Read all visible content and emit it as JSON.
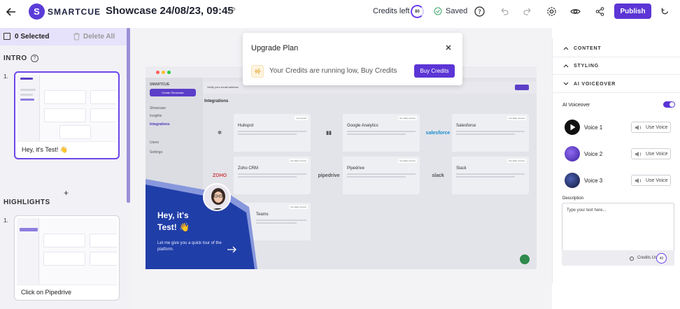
{
  "header": {
    "logo_text": "SMARTCUE",
    "logo_letter": "S",
    "doc_title": "Showcase 24/08/23, 09:45",
    "credits_left_label": "Credits left",
    "credits_left_value": "80",
    "saved_label": "Saved",
    "publish_label": "Publish"
  },
  "left_panel": {
    "selected_label": "0 Selected",
    "delete_all_label": "Delete All",
    "sections": [
      {
        "title": "INTRO",
        "steps": [
          {
            "number": "1.",
            "caption": "Hey, it's Test! 👋"
          }
        ]
      },
      {
        "title": "HIGHLIGHTS",
        "steps": [
          {
            "number": "1.",
            "caption": "Click on Pipedrive"
          }
        ]
      }
    ],
    "add_symbol": "+"
  },
  "preview": {
    "app_logo": "SMARTCUE",
    "create_button": "Create Showcase",
    "verify_text": "Verify your email address",
    "verify_button": "Verify",
    "sidebar_items": [
      "Showcase",
      "Insights",
      "Integrations",
      "Users",
      "Settings"
    ],
    "page_heading": "Integrations",
    "integrations": [
      {
        "name": "Hubspot",
        "logo": "",
        "tag": "Connected"
      },
      {
        "name": "Google Analytics",
        "logo": "",
        "tag": "Get Early Access"
      },
      {
        "name": "Salesforce",
        "logo": "salesforce",
        "tag": "Get Early Access"
      },
      {
        "name": "Zoho CRM",
        "logo": "ZOHO",
        "tag": "Get Early Access"
      },
      {
        "name": "Pipedrive",
        "logo": "pipedrive",
        "tag": "Get Early Access"
      },
      {
        "name": "Slack",
        "logo": "slack",
        "tag": "Get Early Access"
      },
      {
        "name": "Teams",
        "logo": "",
        "tag": "Get Early Access"
      }
    ],
    "tour": {
      "title_line1": "Hey, it's",
      "title_line2": "Test! 👋",
      "subtitle": "Let me give you a quick tour of the platform."
    }
  },
  "popup": {
    "title": "Upgrade Plan",
    "message": "Your Credits are running low, Buy Credits",
    "button": "Buy Credits"
  },
  "right_panel": {
    "accordions": [
      "CONTENT",
      "STYLING",
      "AI VOICEOVER"
    ],
    "ai_voiceover_label": "AI Voiceover",
    "ai_voiceover_enabled": true,
    "voices": [
      {
        "name": "Voice 1",
        "action": "Use Voice"
      },
      {
        "name": "Voice 2",
        "action": "Use Voice"
      },
      {
        "name": "Voice 3",
        "action": "Use Voice"
      }
    ],
    "description_label": "Description",
    "description_placeholder": "Type your text here...",
    "credits_used_label": "Credits Used",
    "credits_used_value": "40"
  },
  "colors": {
    "accent": "#5b35d5",
    "tour_blue": "#203ea8",
    "thumb_border": "#6c47ea"
  }
}
